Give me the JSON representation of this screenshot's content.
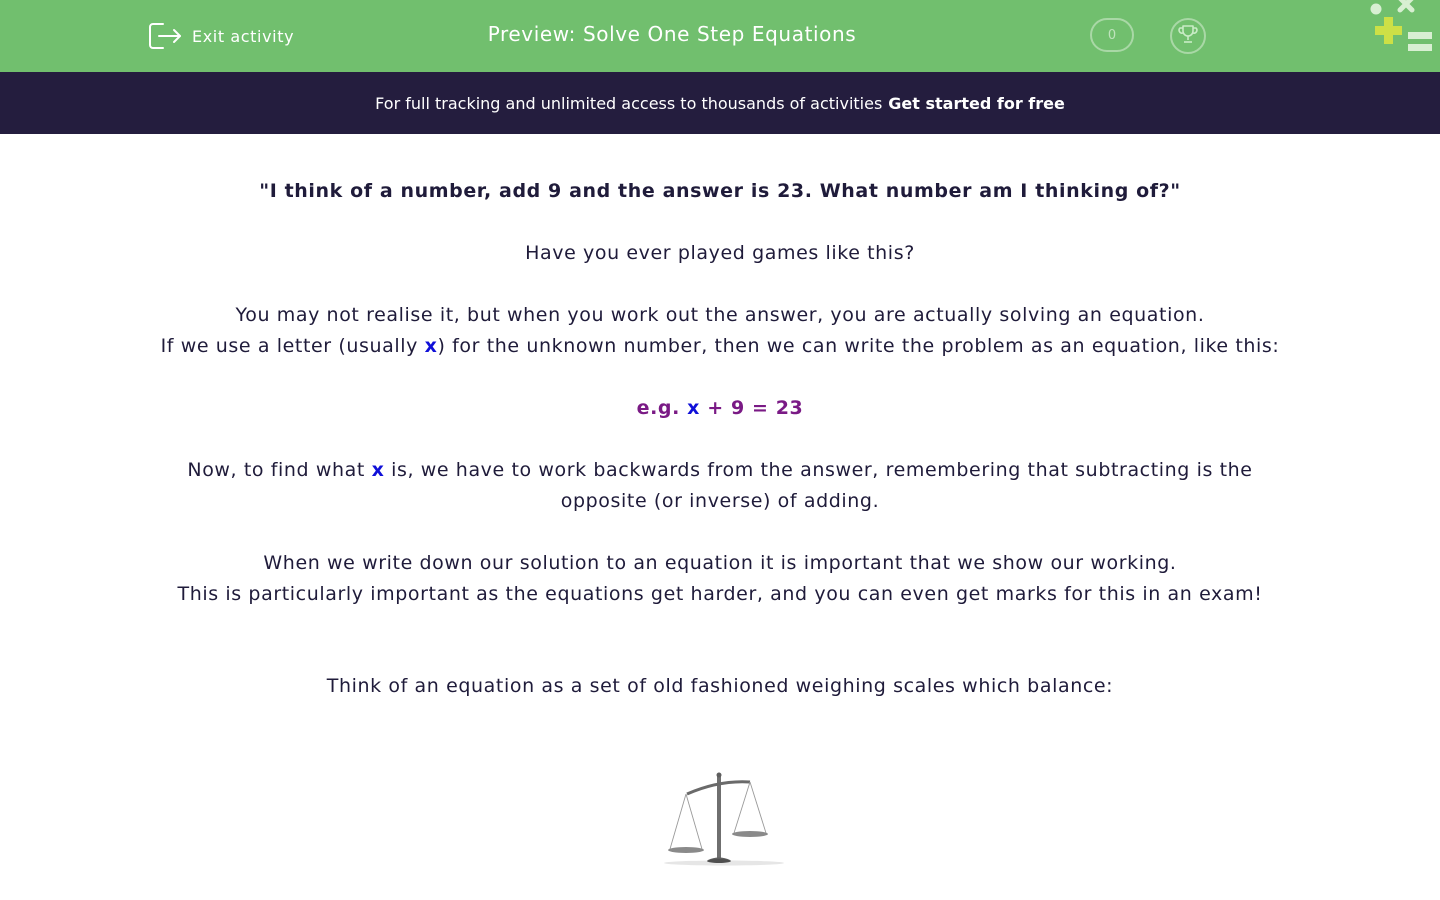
{
  "header": {
    "exit_label": "Exit activity",
    "title": "Preview: Solve One Step Equations",
    "score": "0",
    "background_color": "#71bf6e"
  },
  "promo": {
    "text": "For full tracking and unlimited access to thousands of activities",
    "cta": "Get started for free",
    "background_color": "#241d3e"
  },
  "content": {
    "intro_quote": "\"I think of a number, add 9 and the answer is 23. What number am I thinking of?\"",
    "question": "Have you ever played games like this?",
    "para1_line1": "You may not realise it, but when you work out the answer, you are actually solving an equation.",
    "para1_line2_before": "If we use a letter (usually ",
    "variable": "x",
    "para1_line2_after": ") for the unknown number, then we can write the problem as an equation, like this:",
    "example_prefix": "e.g. ",
    "example_variable": "x",
    "example_rest": " + 9 = 23",
    "para2_before": "Now, to find what ",
    "para2_variable": "x",
    "para2_after": " is, we have to work backwards from the answer, remembering that subtracting is the opposite (or inverse) of adding.",
    "para3_line1": "When we write down our solution to an equation it is important that we show our working.",
    "para3_line2": "This is particularly important as the equations get harder, and you can even get marks for this in an exam!",
    "scales_intro": "Think of an equation as a set of old fashioned weighing scales which balance:",
    "variable_color": "#1010d8",
    "example_color": "#7a1a85"
  },
  "icons": {
    "exit": "exit-icon",
    "trophy": "trophy-icon",
    "logo": "math-symbols-logo",
    "scales": "balance-scales-image"
  }
}
